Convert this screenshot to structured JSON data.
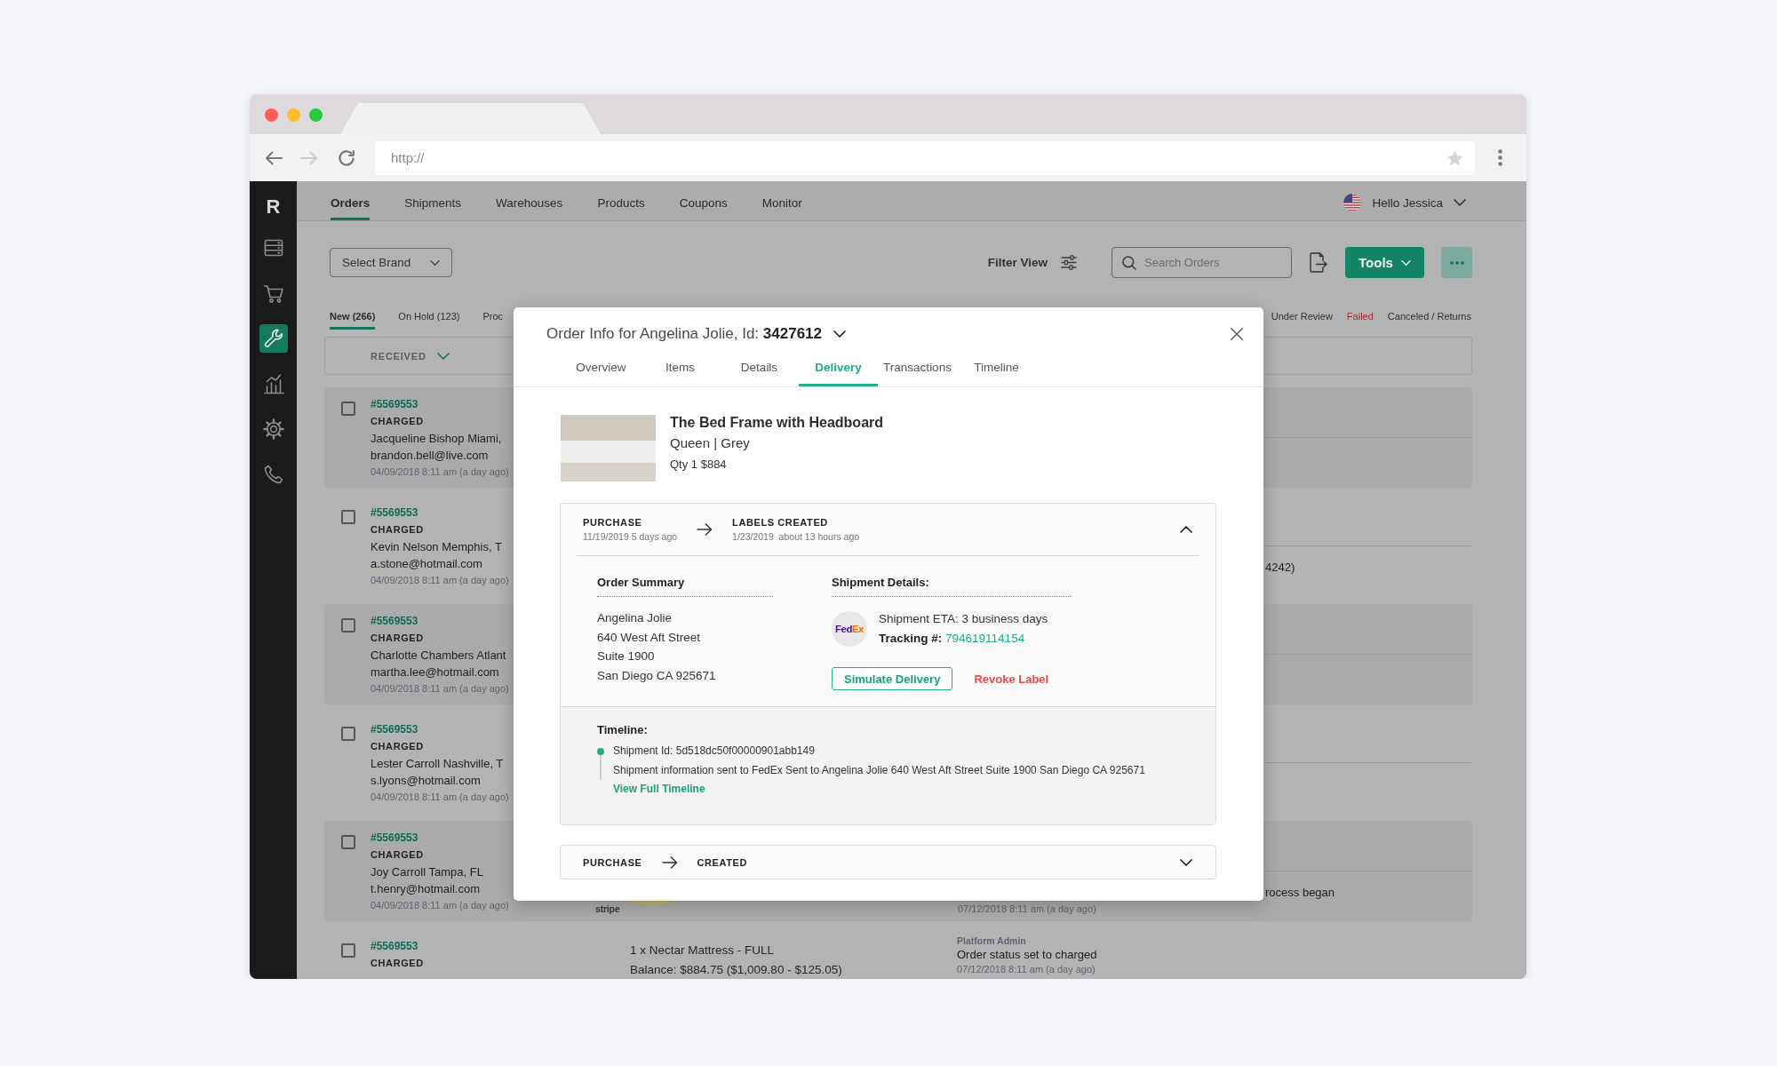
{
  "browser": {
    "address_bar": {
      "placeholder": "http://"
    }
  },
  "sidebar": {
    "logo": "R",
    "items": [
      {
        "selected": false
      },
      {
        "selected": false
      },
      {
        "selected": true
      },
      {
        "selected": false
      },
      {
        "selected": false
      },
      {
        "selected": false
      }
    ]
  },
  "nav": {
    "items": [
      {
        "label": "Orders",
        "selected": true
      },
      {
        "label": "Shipments",
        "selected": false
      },
      {
        "label": "Warehouses",
        "selected": false
      },
      {
        "label": "Products",
        "selected": false
      },
      {
        "label": "Coupons",
        "selected": false
      },
      {
        "label": "Monitor",
        "selected": false
      }
    ],
    "user_menu": {
      "greeting": "Hello Jessica"
    }
  },
  "toolbar": {
    "brand_select": {
      "label": "Select Brand"
    },
    "filter_view": {
      "label": "Filter View"
    },
    "search": {
      "placeholder": "Search Orders"
    },
    "tools_button": {
      "label": "Tools"
    }
  },
  "status_tabs": [
    {
      "label": "New (266)",
      "selected": true,
      "kind": "normal"
    },
    {
      "label": "On Hold (123)",
      "selected": false,
      "kind": "normal"
    },
    {
      "label": "Proc",
      "selected": false,
      "kind": "normal"
    },
    {
      "label": "Under Review",
      "selected": false,
      "kind": "normal"
    },
    {
      "label": "Failed",
      "selected": false,
      "kind": "danger"
    },
    {
      "label": "Canceled / Returns",
      "selected": false,
      "kind": "normal"
    }
  ],
  "list": {
    "sort_header": {
      "label": "RECEIVED"
    },
    "rows": [
      {
        "order": "#5569553",
        "status": "CHARGED",
        "customer": "Jacqueline Bishop Miami,",
        "email": "brandon.bell@live.com",
        "date": "04/09/2018 8:11 am (a day ago)",
        "checked": false
      },
      {
        "order": "#5569553",
        "status": "CHARGED",
        "customer": "Kevin Nelson Memphis, T",
        "email": "a.stone@hotmail.com",
        "date": "04/09/2018 8:11 am (a day ago)",
        "checked": false,
        "note": "4242)"
      },
      {
        "order": "#5569553",
        "status": "CHARGED",
        "customer": "Charlotte Chambers Atlant",
        "email": "martha.lee@hotmail.com",
        "date": "04/09/2018 8:11 am (a day ago)",
        "checked": false
      },
      {
        "order": "#5569553",
        "status": "CHARGED",
        "customer": "Lester Carroll Nashville, T",
        "email": "s.lyons@hotmail.com",
        "date": "04/09/2018 8:11 am (a day ago)",
        "checked": false
      },
      {
        "order": "#5569553",
        "status": "CHARGED",
        "customer": "Joy Carroll Tampa, FL",
        "email": "t.henry@hotmail.com",
        "date": "04/09/2018 8:11 am (a day ago)",
        "checked": false,
        "payment": "stripe",
        "note": "rocess began",
        "note_time": "07/12/2018 8:11 am (a day ago)"
      },
      {
        "order": "#5569553",
        "status": "CHARGED",
        "checked": false,
        "items": [
          "1 x Nectar Mattress - FULL",
          "Balance: $884.75 ($1,009.80 - $125.05)"
        ],
        "activity": {
          "author": "Platform Admin",
          "text": "Order status set to charged",
          "time": "07/12/2018 8:11 am (a day ago)"
        }
      }
    ]
  },
  "modal": {
    "title": "Order Info for Angelina Jolie, Id: **3427612**",
    "tabs": [
      {
        "label": "Overview",
        "selected": false
      },
      {
        "label": "Items",
        "selected": false
      },
      {
        "label": "Details",
        "selected": false
      },
      {
        "label": "Delivery",
        "selected": true
      },
      {
        "label": "Transactions",
        "selected": false
      },
      {
        "label": "Timeline",
        "selected": false
      }
    ],
    "product": {
      "name": "The Bed Frame with Headboard",
      "variant": "Queen | Grey",
      "price": "Qty 1 $884"
    },
    "shipments": [
      {
        "expanded": true,
        "steps": [
          {
            "label": "PURCHASE",
            "date": "11/19/2019 5 days ago"
          },
          {
            "label": "LABELS CREATED",
            "date": "1/23/2019  about 13 hours ago"
          }
        ],
        "order_summary": {
          "title": "Order Summary",
          "lines": [
            "Angelina Jolie",
            "640 West Aft Street",
            "Suite 1900",
            "San Diego CA 925671"
          ]
        },
        "shipment_details": {
          "title": "Shipment Details:",
          "carrier_logo": [
            "Fed",
            "Ex"
          ],
          "eta": "Shipment ETA: 3 business days",
          "tracking_label": "Tracking #:",
          "tracking_number": "794619114154",
          "actions": [
            {
              "label": "Simulate Delivery",
              "kind": "outline"
            },
            {
              "label": "Revoke Label",
              "kind": "danger"
            }
          ]
        },
        "timeline": {
          "title": "Timeline:",
          "events": [
            {
              "title": "Shipment Id: 5d518dc50f00000901abb149",
              "text": "Shipment information sent to FedEx Sent to Angelina Jolie 640 West Aft Street Suite 1900 San Diego CA 925671"
            }
          ],
          "link": "View Full Timeline"
        }
      },
      {
        "expanded": false,
        "steps": [
          {
            "label": "PURCHASE"
          },
          {
            "label": "CREATED"
          }
        ]
      }
    ]
  }
}
